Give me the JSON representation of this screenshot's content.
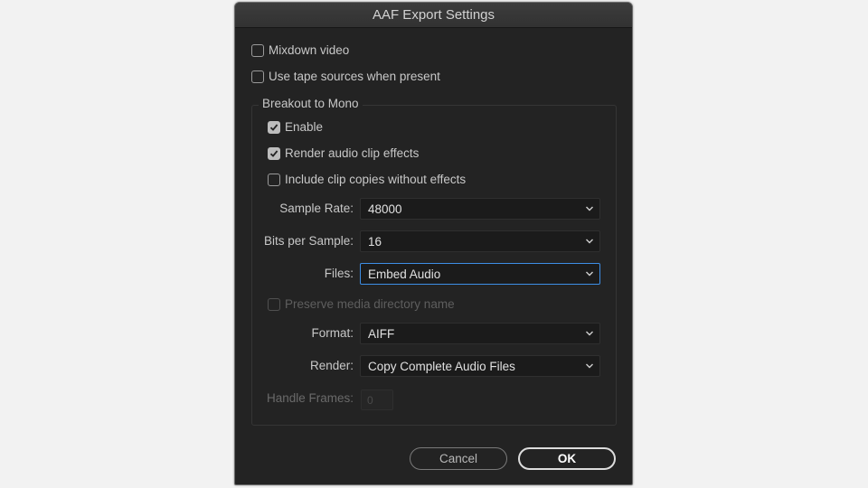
{
  "dialog": {
    "title": "AAF Export Settings",
    "options": {
      "mixdown_video": {
        "label": "Mixdown video",
        "checked": false
      },
      "use_tape_sources": {
        "label": "Use tape sources when present",
        "checked": false
      }
    },
    "breakout": {
      "group_label": "Breakout to Mono",
      "enable": {
        "label": "Enable",
        "checked": true
      },
      "render_effects": {
        "label": "Render audio clip effects",
        "checked": true
      },
      "include_copies": {
        "label": "Include clip copies without effects",
        "checked": false
      },
      "sample_rate": {
        "label": "Sample Rate:",
        "value": "48000"
      },
      "bits_per_sample": {
        "label": "Bits per Sample:",
        "value": "16"
      },
      "files": {
        "label": "Files:",
        "value": "Embed Audio"
      },
      "preserve_dir": {
        "label": "Preserve media directory name",
        "checked": false,
        "disabled": true
      },
      "format": {
        "label": "Format:",
        "value": "AIFF"
      },
      "render": {
        "label": "Render:",
        "value": "Copy Complete Audio Files"
      },
      "handle_frames": {
        "label": "Handle Frames:",
        "value": "0"
      }
    },
    "buttons": {
      "cancel": "Cancel",
      "ok": "OK"
    }
  },
  "colors": {
    "background": "#f2f2f2",
    "dialog": "#232323",
    "focus": "#3d8ee6"
  }
}
